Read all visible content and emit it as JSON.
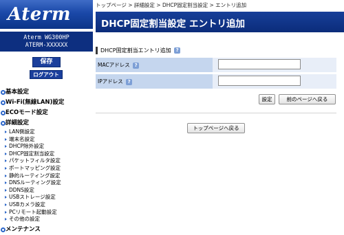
{
  "sidebar": {
    "logo": "Aterm",
    "model_line1": "Aterm WG300HP",
    "model_line2": "ATERM-XXXXXX",
    "save_label": "保存",
    "logout_label": "ログアウト",
    "sections": [
      {
        "label": "基本設定"
      },
      {
        "label": "Wi-Fi(無線LAN)設定"
      },
      {
        "label": "ECOモード設定"
      },
      {
        "label": "詳細設定"
      }
    ],
    "sub_items": [
      {
        "label": "LAN側設定"
      },
      {
        "label": "端末名設定"
      },
      {
        "label": "DHCP除外設定"
      },
      {
        "label": "DHCP固定割当設定"
      },
      {
        "label": "パケットフィルタ設定"
      },
      {
        "label": "ポートマッピング設定"
      },
      {
        "label": "静的ルーティング設定"
      },
      {
        "label": "DNSルーティング設定"
      },
      {
        "label": "DDNS設定"
      },
      {
        "label": "USBストレージ設定"
      },
      {
        "label": "USBカメラ設定"
      },
      {
        "label": "PCリモート起動設定"
      },
      {
        "label": "その他の設定"
      }
    ],
    "last_section": {
      "label": "メンテナンス"
    }
  },
  "breadcrumb": "トップページ > 詳細設定 > DHCP固定割当設定 > エントリ追加",
  "header": {
    "title": "DHCP固定割当設定 エントリ追加"
  },
  "form": {
    "section_title": "DHCP固定割当エントリ追加",
    "help_glyph": "?",
    "mac_label": "MACアドレス",
    "mac_value": "",
    "ip_label": "IPアドレス",
    "ip_value": ""
  },
  "buttons": {
    "set": "設定",
    "back": "前のページへ戻る",
    "top": "トップページへ戻る"
  },
  "colors": {
    "header_bg": "#0c2f7e",
    "label_bg": "#c5d6ee",
    "row_bg": "#e8eef8",
    "bullet": "#2b65c8"
  }
}
